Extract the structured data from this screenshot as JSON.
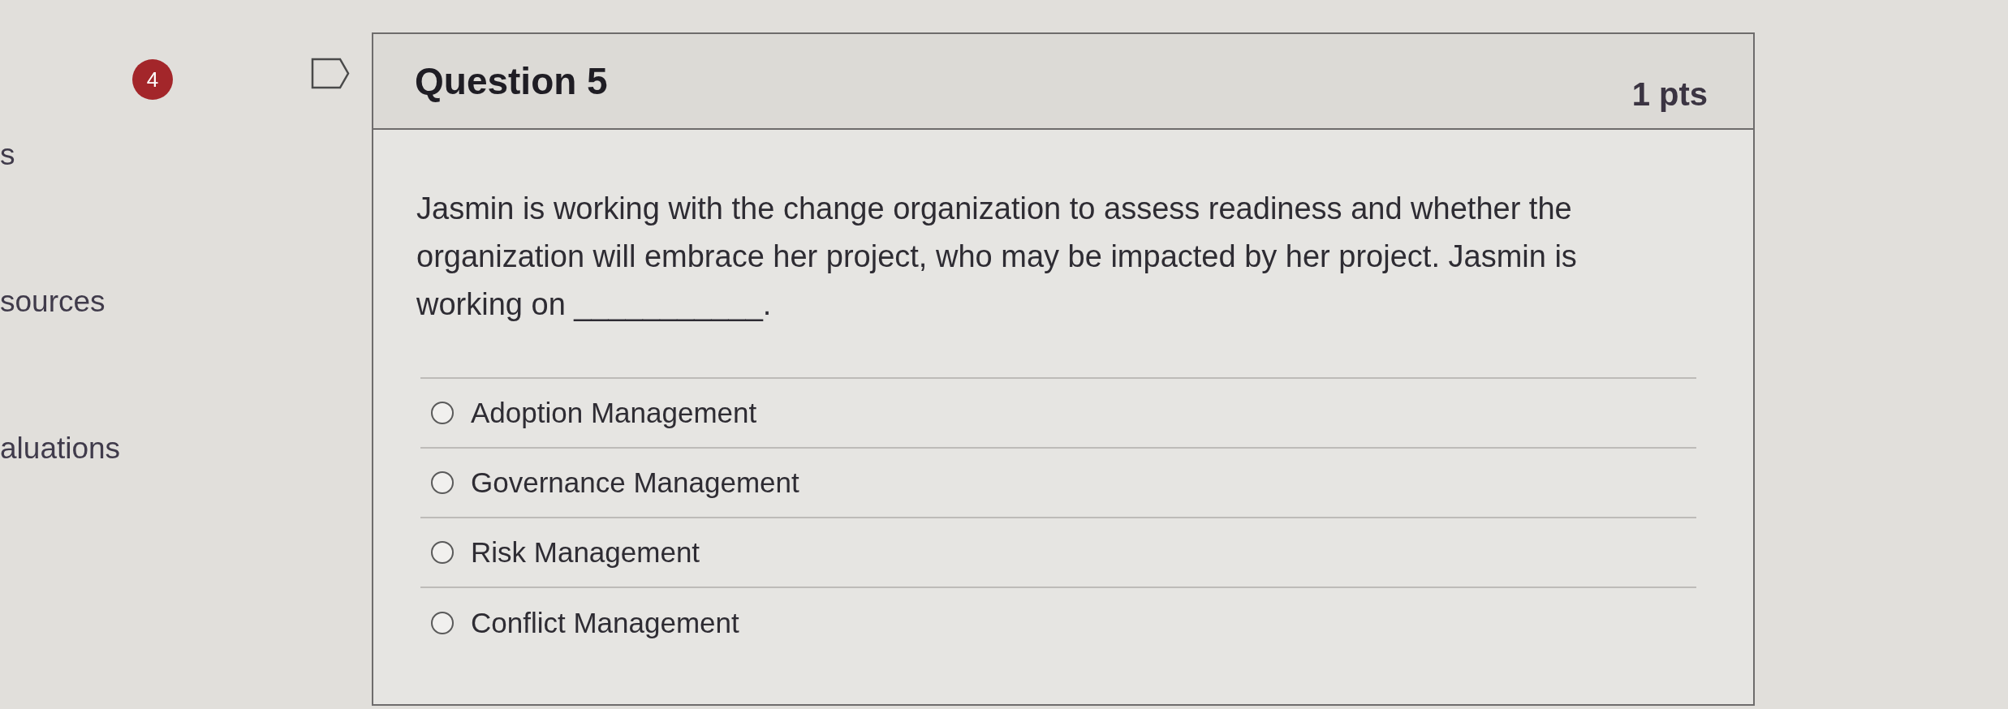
{
  "sidebar": {
    "items": [
      {
        "label": "s"
      },
      {
        "label": "sources"
      },
      {
        "label": "aluations"
      }
    ]
  },
  "badge": {
    "count": "4"
  },
  "question": {
    "title": "Question 5",
    "points": "1 pts",
    "flagged": false,
    "text": "Jasmin is working with the change organization to assess readiness and whether the organization will embrace her project, who may be impacted by her project. Jasmin is working on ___________.",
    "answers": [
      {
        "label": "Adoption Management",
        "selected": false
      },
      {
        "label": "Governance Management",
        "selected": false
      },
      {
        "label": "Risk Management",
        "selected": false
      },
      {
        "label": "Conflict Management",
        "selected": false
      }
    ]
  }
}
